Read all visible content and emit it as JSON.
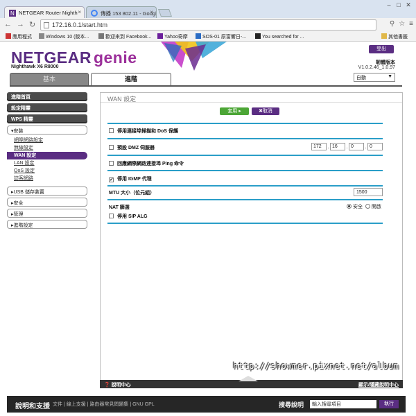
{
  "browser": {
    "tabs": [
      {
        "title": "NETGEAR Router Nighth",
        "active": true
      },
      {
        "title": "傳播 153 802.11 - Googl",
        "active": false
      }
    ],
    "url": "172.16.0.1/start.htm",
    "bookmarks": [
      "應用程式",
      "Windows 10 (版本...",
      "歡迎來到 Facebook...",
      "Yahoo奇摩",
      "SOS-01 原富響日-...",
      "You searched for ...",
      "其他書籤"
    ]
  },
  "header": {
    "brand": "NETGEAR",
    "genie": "genie",
    "model": "Nighthawk X6 R8000",
    "logout_label": "登出",
    "firmware_label": "韌體版本",
    "firmware_version": "V1.0.2.46_1.0.97",
    "language": "自動"
  },
  "main_tabs": {
    "basic": "基本",
    "advanced": "進階"
  },
  "sidebar": {
    "top_items": [
      "進階首頁",
      "設定精靈",
      "WPS 精靈"
    ],
    "setup_section": "▾安裝",
    "setup_items": [
      "網際網路設定",
      "無線設定",
      "WAN 設定",
      "LAN 設定",
      "QoS 設定",
      "訪客網路"
    ],
    "selected_item": "WAN 設定",
    "other_sections": [
      "▸USB 儲存裝置",
      "▸安全",
      "▸管理",
      "▸進階設定"
    ]
  },
  "content": {
    "title": "WAN 設定",
    "apply_label": "套用 ▸",
    "cancel_label": "✖取消",
    "disable_dos_label": "停用連接埠掃描和 DoS 保護",
    "disable_dos_checked": false,
    "dmz_label": "預設 DMZ 伺服器",
    "dmz_checked": false,
    "dmz_ip": [
      "172",
      "16",
      "0",
      "0"
    ],
    "ping_label": "回應網際網路連接埠 Ping 命令",
    "ping_checked": false,
    "igmp_label": "停用 IGMP 代理",
    "igmp_checked": true,
    "mtu_label": "MTU 大小（位元組）",
    "mtu_value": "1500",
    "nat_label": "NAT 篩選",
    "nat_options": [
      "安全",
      "開啟"
    ],
    "nat_selected": "安全",
    "sip_label": "停用 SIP ALG",
    "sip_checked": false
  },
  "helpbar": {
    "help_center": "說明中心",
    "show_help": "顯示/隱藏說明中心"
  },
  "footer": {
    "title": "說明和支援",
    "links": "文件 | 線上支援 | 路由器常見問題集 | GNU GPL",
    "search_label": "搜尋說明",
    "search_placeholder": "輸入搜尋項目",
    "go_label": "執行"
  },
  "watermark": "http://showmer.pixnet.net/album",
  "colors": {
    "brand": "#5a2d82",
    "apply": "#4ca636",
    "divider": "#2a9ec8"
  }
}
